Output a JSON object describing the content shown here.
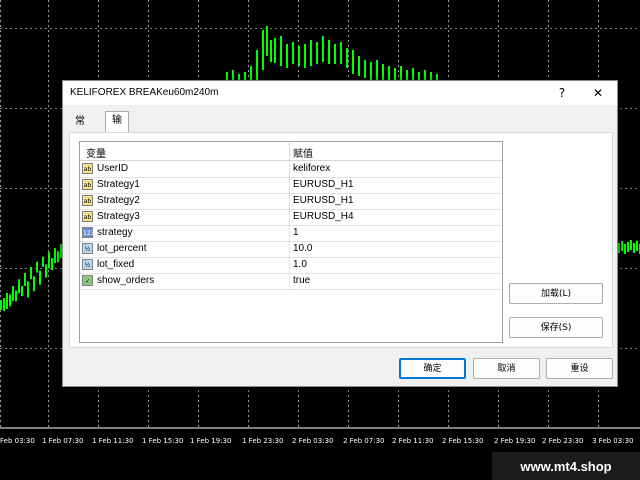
{
  "window": {
    "title": "KELIFOREX BREAKeu60m240m",
    "help_glyph": "?",
    "close_glyph": "✕"
  },
  "tabs": [
    {
      "label": "常用"
    },
    {
      "label": "输入参数"
    }
  ],
  "table": {
    "headers": {
      "variable": "变量",
      "value": "赋值"
    },
    "rows": [
      {
        "icon": "ab",
        "icon_name": "string-type-icon",
        "name": "UserID",
        "value": "keliforex"
      },
      {
        "icon": "ab",
        "icon_name": "string-type-icon",
        "name": "Strategy1",
        "value": "EURUSD_H1"
      },
      {
        "icon": "ab",
        "icon_name": "string-type-icon",
        "name": "Strategy2",
        "value": "EURUSD_H1"
      },
      {
        "icon": "ab",
        "icon_name": "string-type-icon",
        "name": "Strategy3",
        "value": "EURUSD_H4"
      },
      {
        "icon": "123",
        "icon_name": "integer-type-icon",
        "name": "strategy",
        "value": "1"
      },
      {
        "icon": "½",
        "icon_name": "double-type-icon",
        "name": "lot_percent",
        "value": "10.0"
      },
      {
        "icon": "½",
        "icon_name": "double-type-icon",
        "name": "lot_fixed",
        "value": "1.0"
      },
      {
        "icon": "✓",
        "icon_name": "bool-type-icon",
        "name": "show_orders",
        "value": "true"
      }
    ]
  },
  "buttons": {
    "load": "加载(L)",
    "save": "保存(S)",
    "ok": "确定",
    "cancel": "取消",
    "reset": "重设"
  },
  "chart": {
    "time_axis": [
      "Feb 03:30",
      "1 Feb 07:30",
      "1 Feb 11:30",
      "1 Feb 15:30",
      "1 Feb 19:30",
      "1 Feb 23:30",
      "2 Feb 03:30",
      "2 Feb 07:30",
      "2 Feb 11:30",
      "2 Feb 15:30",
      "2 Feb 19:30",
      "2 Feb 23:30",
      "3 Feb 03:30"
    ],
    "candle_color": "#00ff00",
    "grid_color": "#ffffff"
  },
  "watermark": "www.mt4.shop"
}
